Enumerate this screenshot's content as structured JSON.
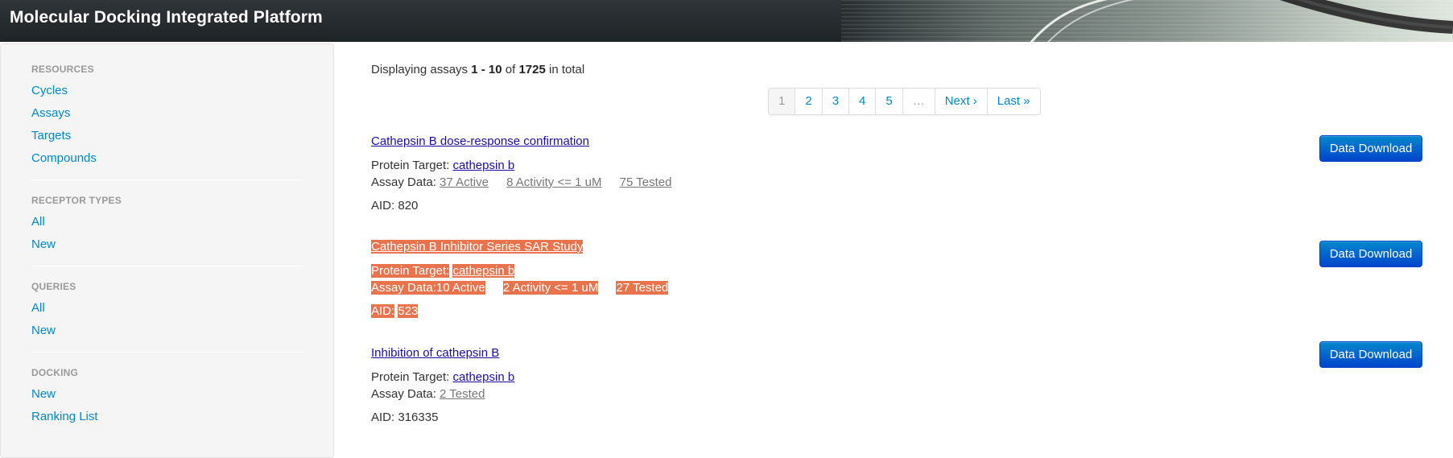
{
  "header": {
    "title": "Molecular Docking Integrated Platform"
  },
  "sidebar": {
    "sections": [
      {
        "header": "Resources",
        "items": [
          "Cycles",
          "Assays",
          "Targets",
          "Compounds"
        ]
      },
      {
        "header": "Receptor Types",
        "items": [
          "All",
          "New"
        ]
      },
      {
        "header": "Queries",
        "items": [
          "All",
          "New"
        ]
      },
      {
        "header": "Docking",
        "items": [
          "New",
          "Ranking List"
        ]
      }
    ]
  },
  "summary": {
    "prefix": "Displaying assays",
    "range": "1 - 10",
    "of": "of",
    "total": "1725",
    "suffix": "in total"
  },
  "pagination": {
    "pages": [
      "1",
      "2",
      "3",
      "4",
      "5",
      "…",
      "Next ›",
      "Last »"
    ],
    "active": "1"
  },
  "assays": [
    {
      "title": "Cathepsin B dose-response confirmation",
      "protein_label": "Protein Target:",
      "protein": "cathepsin b",
      "data_label": "Assay Data:",
      "stats": [
        "37 Active",
        "8 Activity <= 1 uM",
        "75 Tested"
      ],
      "aid_label": "AID:",
      "aid": "820",
      "download_label": "Data Download"
    },
    {
      "title": "Cathepsin B Inhibitor Series SAR Study",
      "protein_label": "Protein Target:",
      "protein": "cathepsin b",
      "data_label": "Assay Data:",
      "stats": [
        "10 Active",
        "2 Activity <= 1 uM",
        "27 Tested"
      ],
      "aid_label": "AID:",
      "aid": "523",
      "download_label": "Data Download",
      "highlighted": true
    },
    {
      "title": "Inhibition of cathepsin B",
      "protein_label": "Protein Target:",
      "protein": "cathepsin b",
      "data_label": "Assay Data:",
      "stats": [
        "2 Tested"
      ],
      "aid_label": "AID:",
      "aid": "316335",
      "download_label": "Data Download"
    }
  ],
  "colors": {
    "link": "#0088cc",
    "title_link": "#1a0dab",
    "highlight": "#e8734c",
    "button": "#0044cc"
  }
}
